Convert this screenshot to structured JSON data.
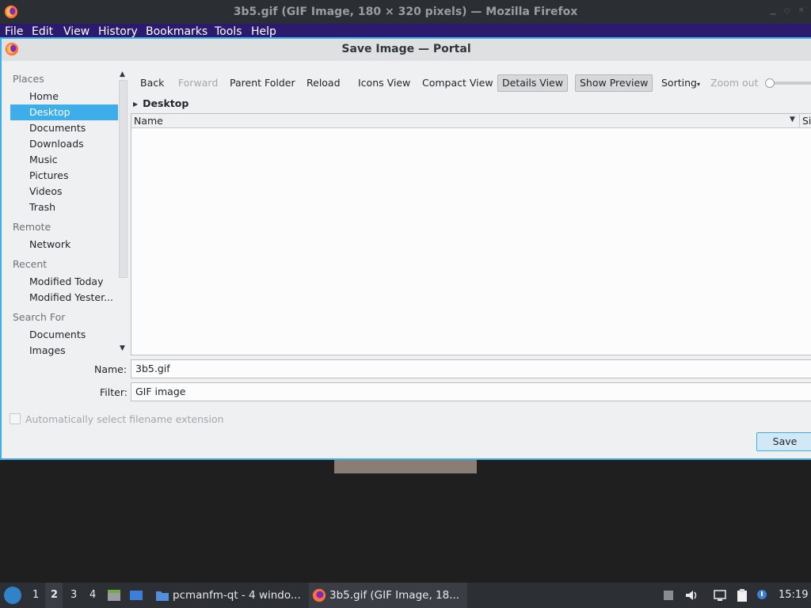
{
  "firefox": {
    "title": "3b5.gif (GIF Image, 180 × 320 pixels) — Mozilla Firefox",
    "menu": [
      "File",
      "Edit",
      "View",
      "History",
      "Bookmarks",
      "Tools",
      "Help"
    ]
  },
  "dialog": {
    "title": "Save Image — Portal",
    "places": {
      "places_header": "Places",
      "places_items": [
        "Home",
        "Desktop",
        "Documents",
        "Downloads",
        "Music",
        "Pictures",
        "Videos",
        "Trash"
      ],
      "remote_header": "Remote",
      "remote_items": [
        "Network"
      ],
      "recent_header": "Recent",
      "recent_items": [
        "Modified Today",
        "Modified Yester..."
      ],
      "search_header": "Search For",
      "search_items": [
        "Documents",
        "Images"
      ],
      "selected": "Desktop"
    },
    "toolbar": {
      "back": "Back",
      "forward": "Forward",
      "parent": "Parent Folder",
      "reload": "Reload",
      "icons_view": "Icons View",
      "compact_view": "Compact View",
      "details_view": "Details View",
      "show_preview": "Show Preview",
      "sorting": "Sorting",
      "zoom_out": "Zoom out"
    },
    "breadcrumb": "Desktop",
    "file_list": {
      "columns": [
        "Name",
        "Si"
      ],
      "rows": []
    },
    "name_label": "Name:",
    "name_value": "3b5.gif",
    "filter_label": "Filter:",
    "filter_value": "GIF image",
    "auto_extension_label": "Automatically select filename extension",
    "save_label": "Save"
  },
  "taskbar": {
    "workspaces": [
      "1",
      "2",
      "3",
      "4"
    ],
    "active_workspace": "2",
    "tasks": [
      "pcmanfm-qt - 4 windo...",
      "3b5.gif (GIF Image, 18..."
    ],
    "clock": "15:19"
  },
  "colors": {
    "accent": "#3daee9",
    "menubar": "#2c1a6e",
    "taskbar": "#2c2f34"
  }
}
